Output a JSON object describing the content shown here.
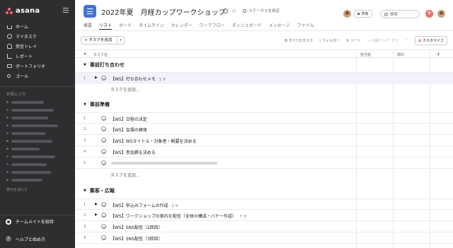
{
  "sidebar": {
    "logo": "asana",
    "nav": [
      {
        "label": "ホーム",
        "icon": "home-icon"
      },
      {
        "label": "マイタスク",
        "icon": "check-circle-icon"
      },
      {
        "label": "受信トレイ",
        "icon": "bell-icon"
      },
      {
        "label": "レポート",
        "icon": "chart-icon"
      },
      {
        "label": "ポートフォリオ",
        "icon": "folder-icon"
      },
      {
        "label": "ゴール",
        "icon": "person-icon"
      }
    ],
    "favorites_header": "お気に入り",
    "collapse_label": "表示を減らす",
    "invite_label": "チームメイトを招待",
    "help_label": "ヘルプと始め方",
    "help_glyph": "?"
  },
  "header": {
    "title": "2022年夏　月経カップワークショップ",
    "status_label": "ステータスを設定",
    "share_label": "共有",
    "search_placeholder": "検索",
    "add_glyph": "+"
  },
  "tabs": [
    "概要",
    "リスト",
    "ボード",
    "タイムライン",
    "カレンダー",
    "ワークフロー",
    "ダッシュボード",
    "メッセージ",
    "ファイル"
  ],
  "active_tab": "リスト",
  "toolbar": {
    "add_task_label": "+ タスクを追加",
    "all_tasks": "すべてのタスク",
    "filter": "フィルター",
    "sort": "ソート",
    "public_link": "公開リンク: オフ",
    "more": "···",
    "customize": "カスタマイズ"
  },
  "columns": {
    "hash": "#",
    "task_name": "タスク名",
    "assignee": "担当者",
    "due_date": "期日",
    "add": "+"
  },
  "sections": [
    {
      "title": "事前打ち合わせ",
      "tasks": [
        {
          "num": "1",
          "name": "【WS】打ち合わせメモ",
          "sub": "1 サ",
          "expand": true
        }
      ],
      "add_label": "タスクを追加..."
    },
    {
      "title": "事前準備",
      "tasks": [
        {
          "num": "1",
          "name": "【WS】日程の決定"
        },
        {
          "num": "2",
          "name": "【WS】会場の確保"
        },
        {
          "num": "3",
          "name": "【WS】WSタイトル・対象者・概要を決める"
        },
        {
          "num": "4",
          "name": "【WS】参加費を決める"
        },
        {
          "num": "5",
          "name": ""
        }
      ],
      "add_label": "タスクを追加..."
    },
    {
      "title": "集客・広報",
      "tasks": [
        {
          "num": "1",
          "name": "【WS】申込みフォームの作成",
          "sub": "2 サ",
          "expand": true
        },
        {
          "num": "2",
          "name": "【WS】ワークショップの案内を配信（全体の構成・バナー作成）",
          "sub": "7 サ",
          "expand": true
        },
        {
          "num": "3",
          "name": "【WS】SNS配信（2回目）"
        },
        {
          "num": "4",
          "name": "【WS】SNS配信（3回目）"
        }
      ]
    }
  ],
  "colors": {
    "sidebar_bg": "#2e2e30",
    "accent_blue": "#4573d2",
    "add_red": "#f06a6a",
    "row_highlight": "#f1f2fc"
  }
}
